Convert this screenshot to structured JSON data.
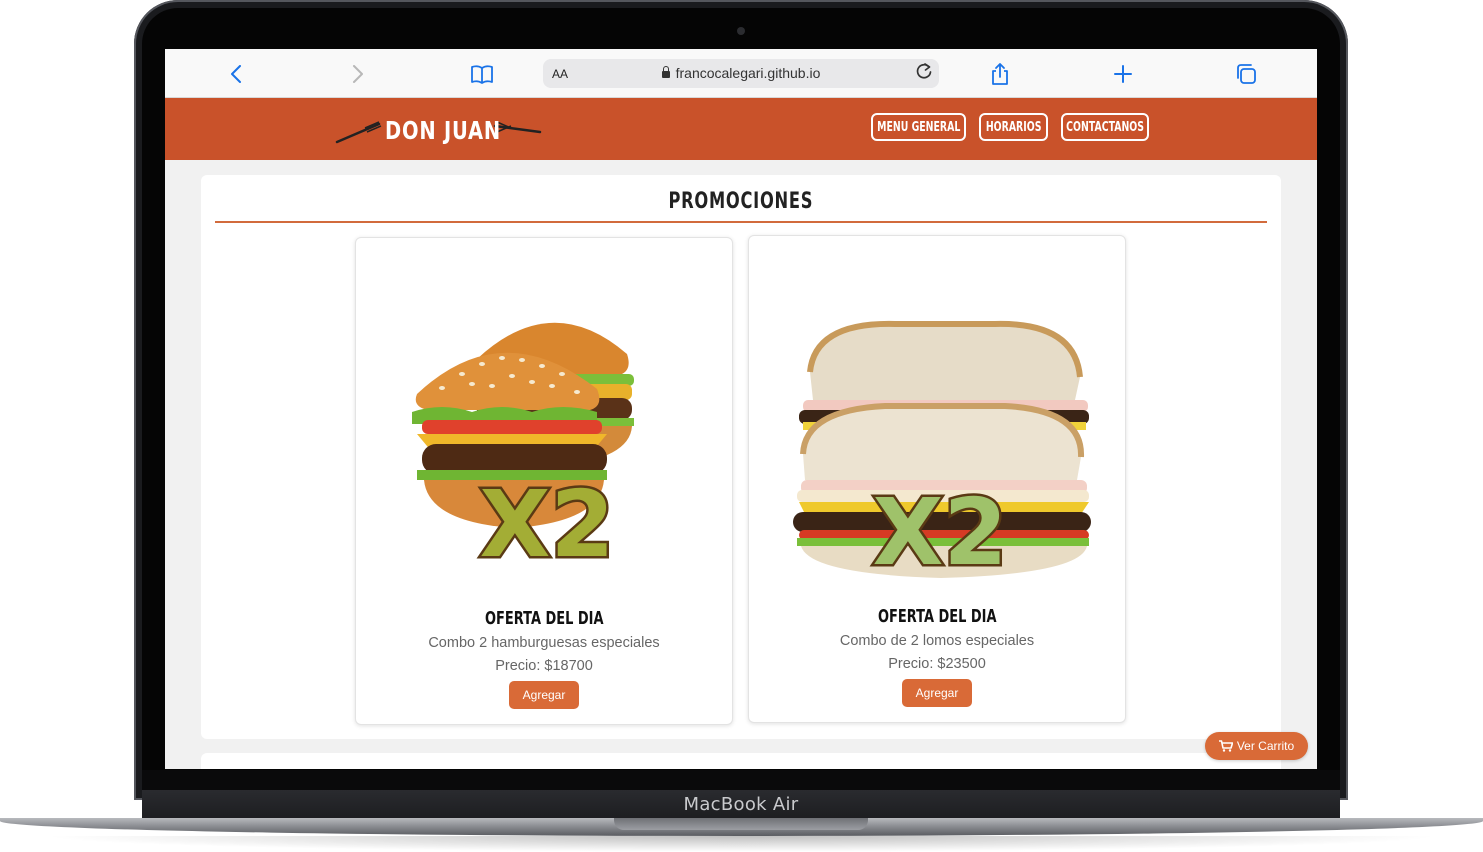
{
  "device": {
    "brand_label": "MacBook Air"
  },
  "browser": {
    "text_size_label": "AA",
    "url": "francocalegari.github.io",
    "icons": [
      "back-icon",
      "forward-icon",
      "bookmarks-icon",
      "lock-icon",
      "reload-icon",
      "share-icon",
      "new-tab-icon",
      "tabs-icon"
    ]
  },
  "site": {
    "logo_text": "DON JUAN",
    "nav": [
      {
        "label": "MENU GENERAL"
      },
      {
        "label": "HORARIOS"
      },
      {
        "label": "CONTACTANOS"
      }
    ],
    "brand_color": "#c9522a",
    "accent_color": "#d96a37"
  },
  "promotions": {
    "title": "PROMOCIONES",
    "cards": [
      {
        "image_badge": "X2",
        "title": "OFERTA DEL DIA",
        "description": "Combo 2 hamburguesas especiales",
        "price": "Precio: $18700",
        "button_label": "Agregar"
      },
      {
        "image_badge": "X2",
        "title": "OFERTA DEL DIA",
        "description": "Combo de 2 lomos especiales",
        "price": "Precio: $23500",
        "button_label": "Agregar"
      }
    ]
  },
  "cart": {
    "label": "Ver Carrito",
    "icon": "cart-icon"
  }
}
